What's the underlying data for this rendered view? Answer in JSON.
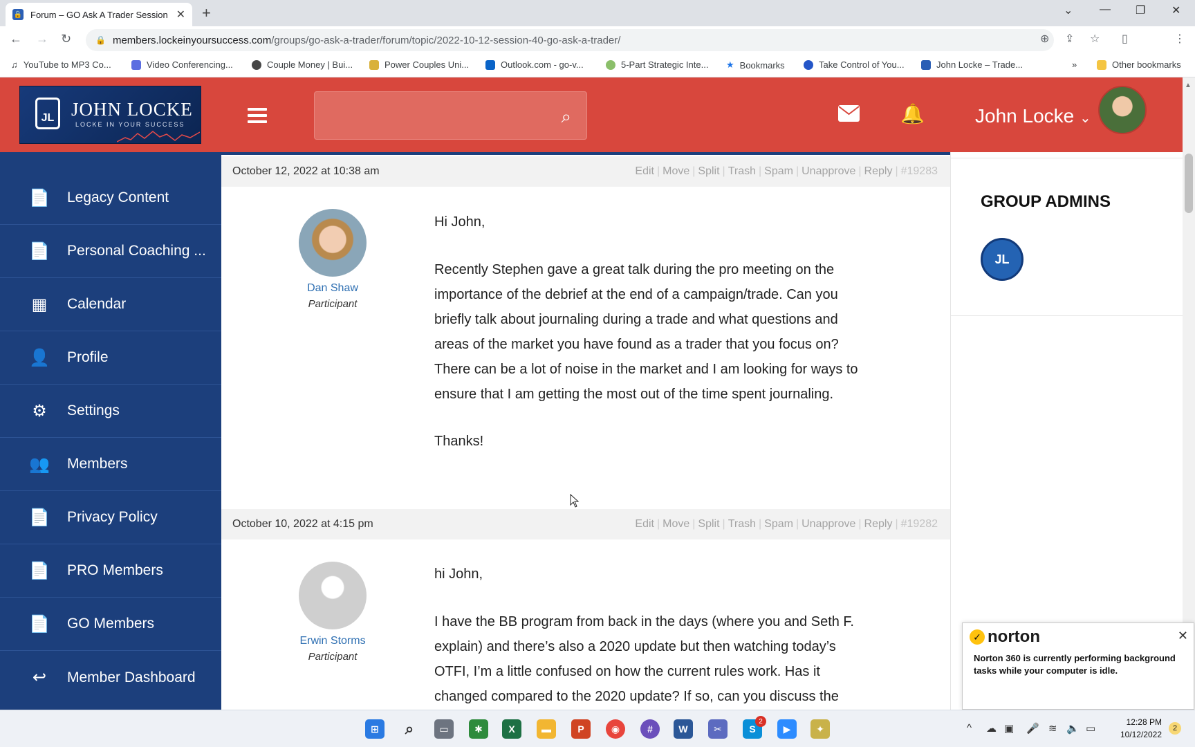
{
  "browser": {
    "tab_title": "Forum – GO Ask A Trader Session",
    "url_host": "members.lockeinyoursuccess.com",
    "url_path": "/groups/go-ask-a-trader/forum/topic/2022-10-12-session-40-go-ask-a-trader/",
    "bookmarks": [
      "YouTube to MP3 Co...",
      "Video Conferencing...",
      "Couple Money | Bui...",
      "Power Couples Uni...",
      "Outlook.com - go-v...",
      "5-Part Strategic Inte...",
      "Bookmarks",
      "Take Control of You...",
      "John Locke – Trade..."
    ],
    "other_bookmarks": "Other bookmarks",
    "more_bookmarks": "»"
  },
  "header": {
    "logo_name": "JOHN LOCKE",
    "logo_tagline": "LOCKE IN YOUR SUCCESS",
    "logo_mark": "JL",
    "user_name": "John Locke",
    "user_caret": "⌄"
  },
  "sidebar": {
    "items": [
      {
        "label": "Legacy Content",
        "icon": "📄"
      },
      {
        "label": "Personal Coaching ...",
        "icon": "📄"
      },
      {
        "label": "Calendar",
        "icon": "▦"
      },
      {
        "label": "Profile",
        "icon": "👤"
      },
      {
        "label": "Settings",
        "icon": "⚙"
      },
      {
        "label": "Members",
        "icon": "👥"
      },
      {
        "label": "Privacy Policy",
        "icon": "📄"
      },
      {
        "label": "PRO Members",
        "icon": "📄"
      },
      {
        "label": "GO Members",
        "icon": "📄"
      },
      {
        "label": "Member Dashboard",
        "icon": "↩"
      }
    ]
  },
  "posts": [
    {
      "date": "October 12, 2022 at 10:38 am",
      "actions": [
        "Edit",
        "Move",
        "Split",
        "Trash",
        "Spam",
        "Unapprove",
        "Reply"
      ],
      "post_id": "#19283",
      "author": "Dan Shaw",
      "role": "Participant",
      "greeting": "Hi John,",
      "paragraph": "Recently Stephen gave a great talk during the pro meeting on the importance of the debrief at the end of a campaign/trade. Can you briefly talk about journaling during a trade and what questions and areas of the market you have found as a trader that you focus on? There can be a lot of noise in the market and I am looking for ways to ensure that I am getting the most out of the time spent journaling.",
      "closing": "Thanks!"
    },
    {
      "date": "October 10, 2022 at 4:15 pm",
      "actions": [
        "Edit",
        "Move",
        "Split",
        "Trash",
        "Spam",
        "Unapprove",
        "Reply"
      ],
      "post_id": "#19282",
      "author": "Erwin Storms",
      "role": "Participant",
      "greeting": "hi John,",
      "paragraph": "I have the BB program from back in the days (where you and Seth F. explain) and there’s also a 2020 update but then watching today’s OTFI, I’m a little confused on how the current rules work. Has it changed compared to the 2020 update? If so, can you discuss the"
    }
  ],
  "right_panel": {
    "title": "GROUP ADMINS",
    "admin_logo": "JL"
  },
  "norton": {
    "brand": "norton",
    "message": "Norton 360 is currently performing background tasks while your computer is idle."
  },
  "taskbar": {
    "time": "12:28 PM",
    "date": "10/12/2022",
    "notif_count": "2",
    "skype_badge": "2"
  },
  "colors": {
    "header_red": "#d8473d",
    "sidebar_blue": "#1c3f7c",
    "link_blue": "#2e6fb2"
  }
}
